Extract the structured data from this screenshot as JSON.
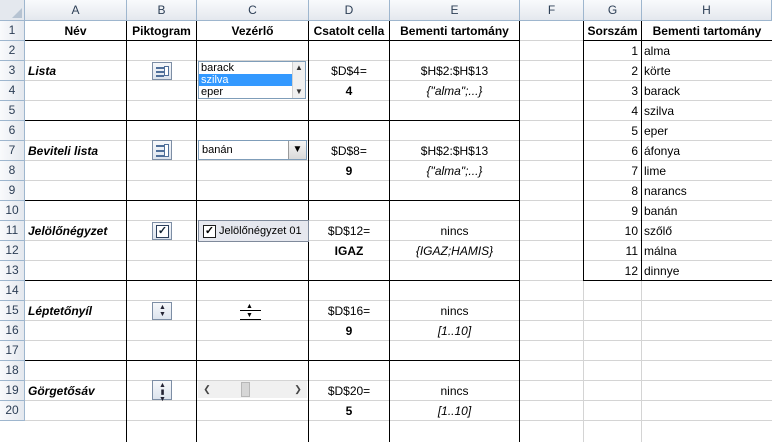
{
  "columns": [
    "A",
    "B",
    "C",
    "D",
    "E",
    "F",
    "G",
    "H"
  ],
  "rows": [
    "1",
    "2",
    "3",
    "4",
    "5",
    "6",
    "7",
    "8",
    "9",
    "10",
    "11",
    "12",
    "13",
    "14",
    "15",
    "16",
    "17",
    "18",
    "19",
    "20"
  ],
  "header": {
    "nev": "Név",
    "piktogram": "Piktogram",
    "vezerlo": "Vezérlő",
    "csatolt": "Csatolt cella",
    "bemeneti": "Bementi tartomány",
    "sorszam": "Sorszám",
    "bemeneti_h": "Bementi tartomány"
  },
  "controls": [
    {
      "name": "Lista",
      "linked_ref": "$D$4=",
      "linked_value": "4",
      "range": "$H$2:$H$13",
      "range_values": "{\"alma\";...}",
      "icon": "listbox-icon",
      "widget": {
        "type": "listbox",
        "items": [
          "barack",
          "szilva",
          "eper"
        ],
        "selected_index": 1
      }
    },
    {
      "name": "Beviteli lista",
      "linked_ref": "$D$8=",
      "linked_value": "9",
      "range": "$H$2:$H$13",
      "range_values": "{\"alma\";...}",
      "icon": "combobox-icon",
      "widget": {
        "type": "combobox",
        "value": "banán"
      }
    },
    {
      "name": "Jelölőnégyzet",
      "linked_ref": "$D$12=",
      "linked_value": "IGAZ",
      "range": "nincs",
      "range_values": "{IGAZ;HAMIS}",
      "icon": "checkbox-icon",
      "widget": {
        "type": "checkbox",
        "label": "Jelölőnégyzet 01",
        "checked": true
      }
    },
    {
      "name": "Léptetőnyíl",
      "linked_ref": "$D$16=",
      "linked_value": "9",
      "range": "nincs",
      "range_values": "[1..10]",
      "icon": "spinner-icon",
      "widget": {
        "type": "spinner"
      }
    },
    {
      "name": "Görgetősáv",
      "linked_ref": "$D$20=",
      "linked_value": "5",
      "range": "nincs",
      "range_values": "[1..10]",
      "icon": "scrollbar-icon",
      "widget": {
        "type": "scrollbar",
        "value": 5,
        "min": 1,
        "max": 10
      }
    }
  ],
  "lookup": [
    {
      "n": "1",
      "v": "alma"
    },
    {
      "n": "2",
      "v": "körte"
    },
    {
      "n": "3",
      "v": "barack"
    },
    {
      "n": "4",
      "v": "szilva"
    },
    {
      "n": "5",
      "v": "eper"
    },
    {
      "n": "6",
      "v": "áfonya"
    },
    {
      "n": "7",
      "v": "lime"
    },
    {
      "n": "8",
      "v": "narancs"
    },
    {
      "n": "9",
      "v": "banán"
    },
    {
      "n": "10",
      "v": "szőlő"
    },
    {
      "n": "11",
      "v": "málna"
    },
    {
      "n": "12",
      "v": "dinnye"
    }
  ],
  "colors": {
    "header_bg": "#e4e8ee",
    "gridline": "#d4d4d4",
    "selection": "#3399ff",
    "border": "#000000"
  }
}
